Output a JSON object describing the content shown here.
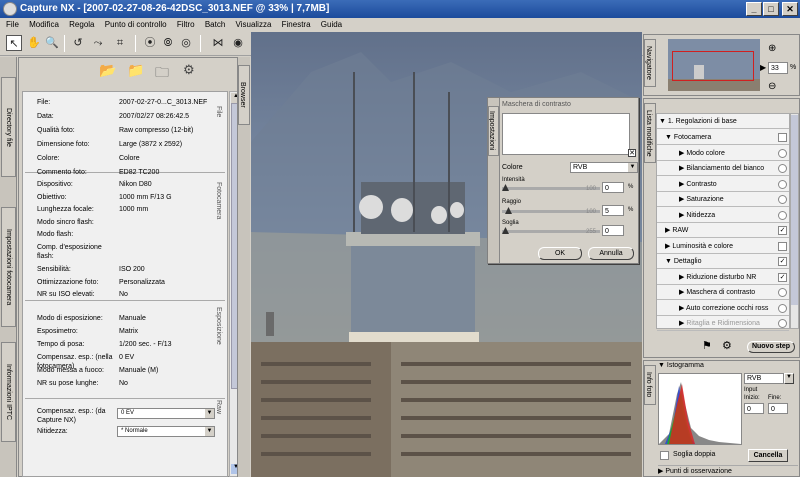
{
  "window": {
    "title": "Capture  NX  - [2007-02-27-08-26-42DSC_3013.NEF  @  33%  |  7,7MB]",
    "minimize": "_",
    "maximize": "□",
    "close": "✕"
  },
  "menu": [
    "File",
    "Modifica",
    "Regola",
    "Punto di controllo",
    "Filtro",
    "Batch",
    "Visualizza",
    "Finestra",
    "Guida"
  ],
  "left_tabs": [
    "Directory file",
    "Impostazioni fotocamera",
    "Informazioni IPTC"
  ],
  "browser_tab": "Browser",
  "info": {
    "rows_file": [
      {
        "label": "File:",
        "value": "2007-02-27-0...C_3013.NEF"
      },
      {
        "label": "Data:",
        "value": "2007/02/27 08:26:42.5"
      },
      {
        "label": "Qualità foto:",
        "value": "Raw compresso (12-bit)"
      },
      {
        "label": "Dimensione foto:",
        "value": "Large (3872 x 2592)"
      },
      {
        "label": "Colore:",
        "value": "Colore"
      },
      {
        "label": "Commento foto:",
        "value": "ED82 TC200"
      }
    ],
    "rows_camera": [
      {
        "label": "Dispositivo:",
        "value": "Nikon D80"
      },
      {
        "label": "Obiettivo:",
        "value": "1000 mm F/13 G"
      },
      {
        "label": "Lunghezza focale:",
        "value": "1000 mm"
      },
      {
        "label": "Modo sincro flash:",
        "value": ""
      },
      {
        "label": "Modo flash:",
        "value": ""
      },
      {
        "label": "Comp. d'esposizione flash:",
        "value": ""
      },
      {
        "label": "Sensibilità:",
        "value": "ISO 200"
      },
      {
        "label": "Ottimizzazione foto:",
        "value": "Personalizzata"
      },
      {
        "label": "NR su ISO elevati:",
        "value": "No"
      }
    ],
    "rows_exposure": [
      {
        "label": "Modo di esposizione:",
        "value": "Manuale"
      },
      {
        "label": "Esposimetro:",
        "value": "Matrix"
      },
      {
        "label": "Tempo di posa:",
        "value": "1/200 sec. - F/13"
      },
      {
        "label": "Compensaz. esp.: (nella fotocamera)",
        "value": "0 EV"
      },
      {
        "label": "Modo messa a fuoco:",
        "value": "Manuale (M)"
      },
      {
        "label": "NR su pose lunghe:",
        "value": "No"
      }
    ],
    "raw_comp_label": "Compensaz. esp.: (da Capture NX)",
    "raw_comp_value": "0 EV",
    "sharp_label": "Nitidezza:",
    "sharp_value": "* Normale",
    "sec_file": "File",
    "sec_camera": "Fotocamera",
    "sec_exposure": "Esposizione",
    "sec_raw": "Raw"
  },
  "usm": {
    "title": "Maschera di contrasto",
    "side_tab": "Impostazioni",
    "colore_label": "Colore",
    "colore_value": "RVB",
    "intensita_label": "Intensità",
    "intensita_max": "100",
    "intensita_value": "0",
    "raggio_label": "Raggio",
    "raggio_max": "100",
    "raggio_value": "5",
    "soglia_label": "Soglia",
    "soglia_max": "255",
    "soglia_value": "0",
    "percent": "%",
    "ok": "OK",
    "annulla": "Annulla",
    "intensita_level": 0,
    "raggio_level": 0.05,
    "soglia_level": 0
  },
  "navigator": {
    "tab": "Navigatore",
    "zoom": "33",
    "percent": "%"
  },
  "edit_list": {
    "tab": "Lista modifiche",
    "step": "1. Regolazioni di base",
    "items": [
      {
        "label": "Fotocamera",
        "level": 1
      },
      {
        "label": "Modo colore",
        "level": 2
      },
      {
        "label": "Bilanciamento del bianco",
        "level": 2
      },
      {
        "label": "Contrasto",
        "level": 2
      },
      {
        "label": "Saturazione",
        "level": 2
      },
      {
        "label": "Nitidezza",
        "level": 2
      },
      {
        "label": "RAW",
        "level": 1
      },
      {
        "label": "Luminosità e colore",
        "level": 1
      },
      {
        "label": "Dettaglio",
        "level": 1
      },
      {
        "label": "Riduzione disturbo NR",
        "level": 2
      },
      {
        "label": "Maschera di contrasto",
        "level": 2
      },
      {
        "label": "Auto correzione occhi ross",
        "level": 2
      },
      {
        "label": "Ritaglia e Ridimensiona",
        "level": 2
      }
    ],
    "new_step": "Nuovo step"
  },
  "photo_info": {
    "tab": "Info foto",
    "histogram": "Istogramma",
    "channel": "RVB",
    "input": "Input",
    "inizio": "Inizio:",
    "fine": "Fine:",
    "inizio_val": "0",
    "fine_val": "0",
    "soglia_doppia": "Soglia doppia",
    "cancella": "Cancella",
    "punti": "Punti di osservazione"
  },
  "colors": {
    "title_bar": "#2356a6",
    "accent_red": "#d02020",
    "sky": "#7a8fa8"
  }
}
